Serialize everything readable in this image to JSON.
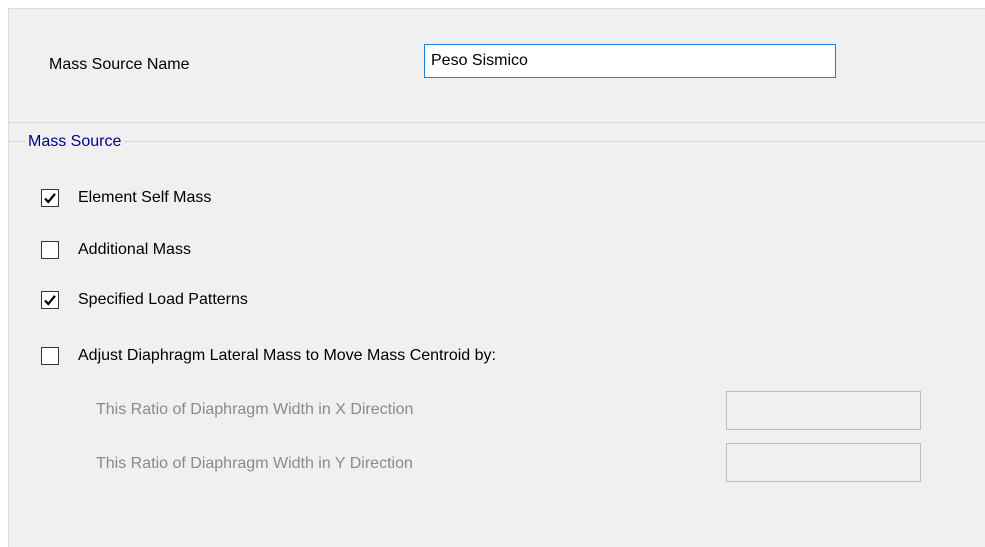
{
  "mass_source_name": {
    "label": "Mass Source Name",
    "value": "Peso Sismico"
  },
  "mass_source_group": {
    "title": "Mass Source",
    "options": [
      {
        "label": "Element Self Mass",
        "checked": true
      },
      {
        "label": "Additional Mass",
        "checked": false
      },
      {
        "label": "Specified Load Patterns",
        "checked": true
      },
      {
        "label": "Adjust Diaphragm Lateral Mass to Move Mass Centroid by:",
        "checked": false
      }
    ],
    "ratio_x_label": "This Ratio of Diaphragm Width in X Direction",
    "ratio_x_value": "",
    "ratio_y_label": "This Ratio of Diaphragm Width in Y Direction",
    "ratio_y_value": ""
  }
}
